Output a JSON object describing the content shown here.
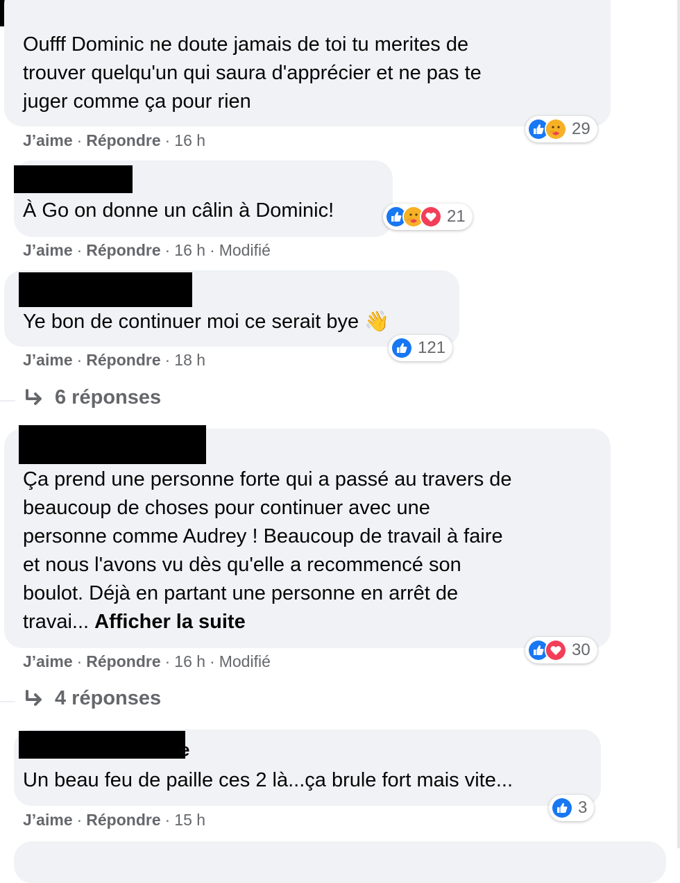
{
  "comments": [
    {
      "lines": [
        "Oufff Dominic ne doute jamais de toi tu merites de",
        "trouver quelqu'un qui saura d'apprécier et ne pas te",
        "juger comme ça pour rien"
      ],
      "like": "J’aime",
      "reply": "Répondre",
      "time": "16 h",
      "reactions": [
        "like-icon",
        "care-icon"
      ],
      "reaction_count": "29"
    },
    {
      "lines": [
        "À Go on donne un câlin à Dominic!"
      ],
      "like": "J’aime",
      "reply": "Répondre",
      "time": "16 h",
      "edited": "Modifié",
      "reactions": [
        "like-icon",
        "care-icon",
        "love-icon"
      ],
      "reaction_count": "21"
    },
    {
      "lines": [
        "Ye bon de continuer moi ce serait bye 👋"
      ],
      "like": "J’aime",
      "reply": "Répondre",
      "time": "18 h",
      "reactions": [
        "like-icon"
      ],
      "reaction_count": "121",
      "replies": "6 réponses"
    },
    {
      "lines": [
        "Ça prend une personne forte qui a passé au travers de",
        "beaucoup de choses pour continuer avec une",
        "personne comme Audrey ! Beaucoup de travail à faire",
        "et nous l'avons vu dès qu'elle a recommencé son",
        "boulot. Déjà en partant une personne en arrêt de",
        "travai..."
      ],
      "see_more": "Afficher la suite",
      "like": "J’aime",
      "reply": "Répondre",
      "time": "16 h",
      "edited": "Modifié",
      "reactions": [
        "like-icon",
        "love-icon"
      ],
      "reaction_count": "30",
      "replies": "4 réponses"
    },
    {
      "lines": [
        "Un beau feu de paille ces 2 là...ça brule fort mais vite..."
      ],
      "name_peek": "e",
      "like": "J’aime",
      "reply": "Répondre",
      "time": "15 h",
      "reactions": [
        "like-icon"
      ],
      "reaction_count": "3"
    }
  ],
  "colors": {
    "bubble": "#f0f2f5",
    "like_blue": "#1877f2",
    "love_red": "#f33e58",
    "care_yellow": "#f7b125",
    "meta_gray": "#65676b"
  }
}
